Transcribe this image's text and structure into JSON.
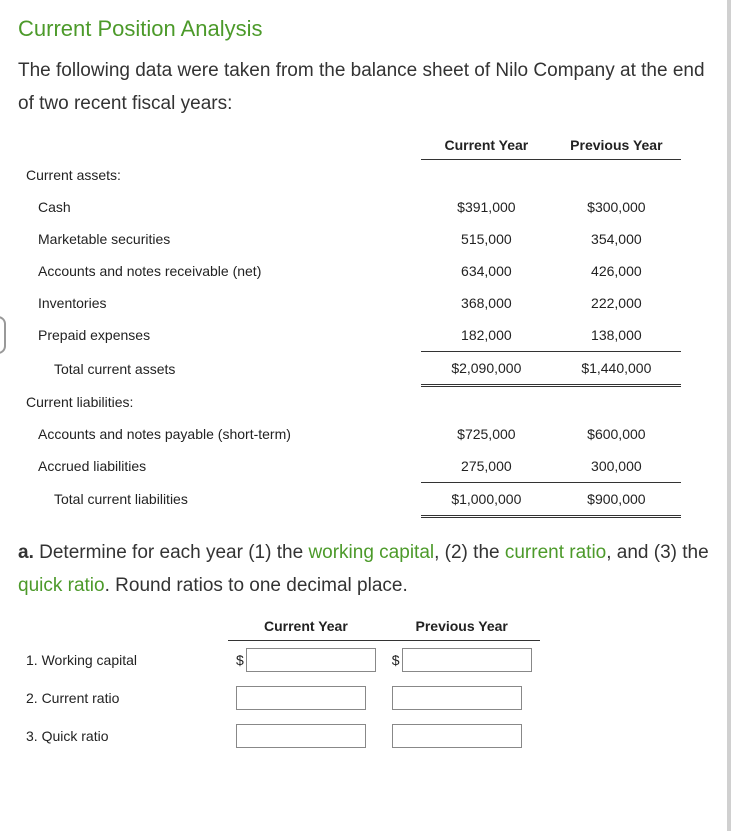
{
  "title": "Current Position Analysis",
  "intro": "The following data were taken from the balance sheet of Nilo Company at the end of two recent fiscal years:",
  "table": {
    "headers": {
      "col1": "Current Year",
      "col2": "Previous Year"
    },
    "section1": "Current assets:",
    "rows1": [
      {
        "label": "Cash",
        "cy": "$391,000",
        "py": "$300,000"
      },
      {
        "label": "Marketable securities",
        "cy": "515,000",
        "py": "354,000"
      },
      {
        "label": "Accounts and notes receivable (net)",
        "cy": "634,000",
        "py": "426,000"
      },
      {
        "label": "Inventories",
        "cy": "368,000",
        "py": "222,000"
      },
      {
        "label": "Prepaid expenses",
        "cy": "182,000",
        "py": "138,000"
      }
    ],
    "total1": {
      "label": "Total current assets",
      "cy": "$2,090,000",
      "py": "$1,440,000"
    },
    "section2": "Current liabilities:",
    "rows2": [
      {
        "label": "Accounts and notes payable (short-term)",
        "cy": "$725,000",
        "py": "$600,000"
      },
      {
        "label": "Accrued liabilities",
        "cy": "275,000",
        "py": "300,000"
      }
    ],
    "total2": {
      "label": "Total current liabilities",
      "cy": "$1,000,000",
      "py": "$900,000"
    }
  },
  "question": {
    "prefix": "a.",
    "text1": "  Determine for each year (1) the ",
    "term1": "working capital",
    "text2": ", (2) the ",
    "term2": "current ratio",
    "text3": ", and (3) the ",
    "term3": "quick ratio",
    "text4": ". Round ratios to one decimal place."
  },
  "answers": {
    "headers": {
      "col1": "Current Year",
      "col2": "Previous Year"
    },
    "rows": [
      {
        "label": "1.  Working capital",
        "dollar": true
      },
      {
        "label": "2.  Current ratio",
        "dollar": false
      },
      {
        "label": "3.  Quick ratio",
        "dollar": false
      }
    ],
    "dollar_sign": "$"
  }
}
